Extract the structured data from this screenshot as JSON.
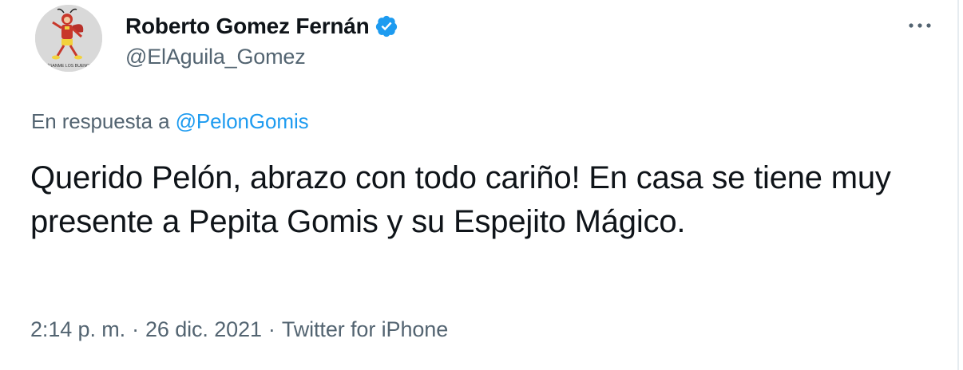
{
  "author": {
    "display_name": "Roberto Gomez Fernán",
    "handle": "@ElAguila_Gomez",
    "avatar_caption": "SÍGANME LOS BUENOS"
  },
  "reply": {
    "prefix": "En respuesta a",
    "mention": "@PelonGomis"
  },
  "tweet": {
    "text": "Querido Pelón, abrazo con todo cariño! En casa se tiene muy presente a Pepita Gomis y su Espejito Mágico."
  },
  "meta": {
    "time": "2:14 p. m.",
    "separator": "·",
    "date": "26 dic. 2021",
    "source": "Twitter for iPhone"
  },
  "icons": {
    "verified": "verified-badge-icon",
    "more": "more-dots-icon"
  },
  "colors": {
    "text": "#0f1419",
    "secondary": "#536471",
    "accent": "#1d9bf0"
  }
}
